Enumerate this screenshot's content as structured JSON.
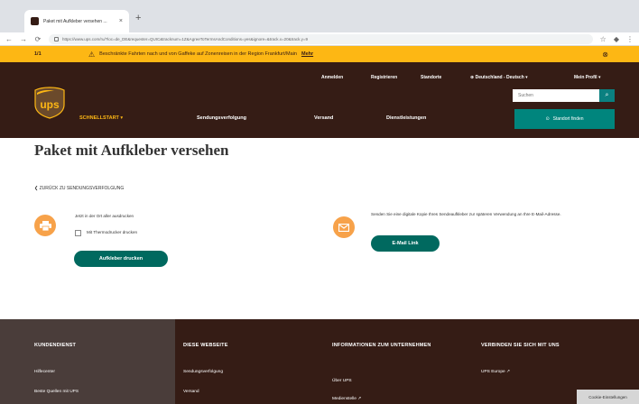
{
  "browser": {
    "tab_title": "Paket mit Aufkleber versehen ...",
    "url": "https://www.ups.com/ru/?loc=de_DE&requester=QUIC&tracknum=1Z&AgreeToTermsAndConditions=yes&ignore=&track.x=20&track.y=9"
  },
  "notice": {
    "count": "1/1",
    "message": "Beschränkte Fahrten nach und von Gaffeke auf Zonenreisen in der Region Frankfurt/Main",
    "link": "Mehr"
  },
  "header": {
    "links": [
      "Anmelden",
      "Registrieren",
      "Standorte",
      "Deutschland - Deutsch",
      "Mein Profil"
    ],
    "search_placeholder": "Suchen",
    "nav": [
      "SCHNELLSTART",
      "Sendungsverfolgung",
      "Versand",
      "Dienstleistungen"
    ],
    "locations_button": "Standort finden"
  },
  "main": {
    "title": "Paket mit Aufkleber versehen",
    "back_link": "ZURÜCK ZU SENDUNGSVERFOLGUNG",
    "option1_text": "Jetzt in der Ort aller ausdrucken",
    "option1_checkbox": "Mit Thermodrucker drucken",
    "option1_button": "Aufkleber drucken",
    "option2_text": "Senden Sie eine digitale Kopie Ihres Sendeaufkleber zur späteren Verwendung an Ihre E-Mail-Adresse.",
    "option2_button": "E-Mail Link"
  },
  "footer": {
    "columns": [
      {
        "heading": "KUNDENDIENST",
        "links": [
          "Hilfecenter",
          "Beste Quellen mit UPS"
        ]
      },
      {
        "heading": "DIESE WEBSEITE",
        "links": [
          "Sendungsverfolgung",
          "Versand"
        ]
      },
      {
        "heading": "INFORMATIONEN ZUM UNTERNEHMEN",
        "links": [
          "Über UPS",
          "Medienstelle"
        ]
      },
      {
        "heading": "VERBINDEN SIE SICH MIT UNS",
        "links": [
          "UPS Europe"
        ]
      }
    ],
    "cookie_button": "Cookie-Einstellungen"
  }
}
